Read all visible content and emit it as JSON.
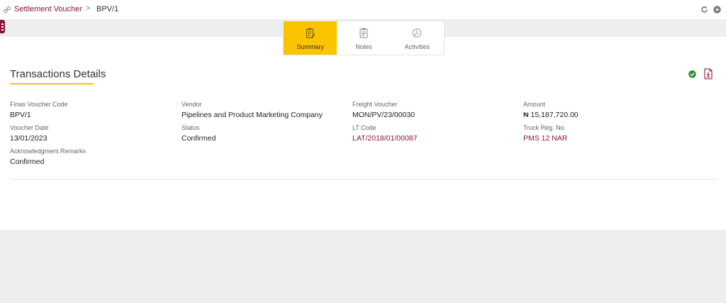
{
  "breadcrumb": {
    "parent": "Settlement Voucher",
    "separator": ">",
    "current": "BPV/1"
  },
  "tabs": [
    {
      "label": "Summary",
      "icon": "clipboard-edit-icon",
      "active": true
    },
    {
      "label": "Notes",
      "icon": "clipboard-notes-icon",
      "active": false
    },
    {
      "label": "Activities",
      "icon": "activity-clock-icon",
      "active": false
    }
  ],
  "section": {
    "title": "Transactions Details"
  },
  "fields": {
    "finas_voucher_code": {
      "label": "Finas Voucher Code",
      "value": "BPV/1"
    },
    "vendor": {
      "label": "Vendor",
      "value": "Pipelines and Product Marketing Company"
    },
    "freight_voucher": {
      "label": "Freight Voucher",
      "value": "MON/PV/23/00030"
    },
    "amount": {
      "label": "Amount",
      "value": "₦ 15,187,720.00"
    },
    "voucher_date": {
      "label": "Voucher Date",
      "value": "13/01/2023"
    },
    "status": {
      "label": "Status",
      "value": "Confirmed"
    },
    "lt_code": {
      "label": "LT Code",
      "value": "LAT/2018/01/00087"
    },
    "truck_reg_no": {
      "label": "Truck Reg. No.",
      "value": "PMS 12 NAR"
    },
    "acknowledgment_remarks": {
      "label": "Acknowledgment Remarks",
      "value": "Confirmed"
    }
  },
  "colors": {
    "brand": "#8a1538",
    "accent": "#fbc400",
    "success": "#2e8b2e"
  }
}
